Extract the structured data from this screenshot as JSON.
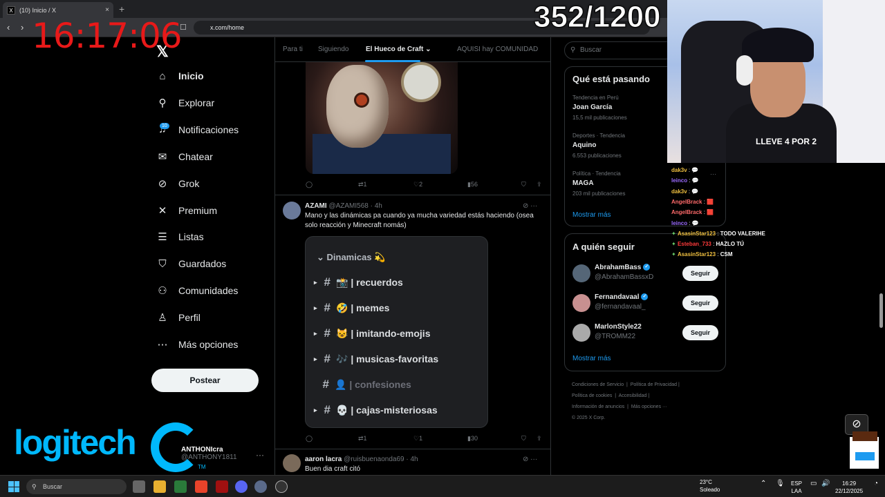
{
  "browser": {
    "tab_title": "(10) Inicio / X",
    "tab_favicon": "X",
    "tab_close": "×",
    "new_tab": "+",
    "url": "x.com/home"
  },
  "overlay": {
    "clock": "16:17:06",
    "counter": "352/1200"
  },
  "sidebar": {
    "logo": "𝕏",
    "notif_badge": "10",
    "items": [
      {
        "label": "Inicio",
        "icon": "home-icon",
        "glyph": "⌂"
      },
      {
        "label": "Explorar",
        "icon": "search-icon",
        "glyph": "⚲"
      },
      {
        "label": "Notificaciones",
        "icon": "bell-icon",
        "glyph": "♫"
      },
      {
        "label": "Chatear",
        "icon": "mail-icon",
        "glyph": "✉"
      },
      {
        "label": "Grok",
        "icon": "grok-icon",
        "glyph": "⊘"
      },
      {
        "label": "Premium",
        "icon": "x-icon",
        "glyph": "✕"
      },
      {
        "label": "Listas",
        "icon": "list-icon",
        "glyph": "☰"
      },
      {
        "label": "Guardados",
        "icon": "bookmark-icon",
        "glyph": "⛉"
      },
      {
        "label": "Comunidades",
        "icon": "people-icon",
        "glyph": "⚇"
      },
      {
        "label": "Perfil",
        "icon": "person-icon",
        "glyph": "♙"
      },
      {
        "label": "Más opciones",
        "icon": "more-circle-icon",
        "glyph": "⋯"
      }
    ],
    "post_button": "Postear",
    "account_name": "ANTHONIcra",
    "account_handle": "@ANTHONY1811",
    "account_more": "···"
  },
  "sponsor": {
    "name": "logitech",
    "tm": "TM"
  },
  "feed": {
    "tabs": [
      "Para ti",
      "Siguiendo",
      "El Hueco de Craft",
      "AQUISI hay COMUNIDAD"
    ],
    "tab_chevron": "⌄",
    "post1_actions": {
      "replies": "",
      "reposts": "1",
      "likes": "2",
      "views": "56"
    },
    "post2": {
      "name": "AZAMI",
      "handle": "@AZAMI568",
      "time": "· 4h",
      "text": "Mano y las dinámicas pa cuando ya mucha variedad estás haciendo (osea solo reacción y Minecraft nomás)",
      "actions": {
        "replies": "",
        "reposts": "1",
        "likes": "1",
        "views": "30"
      }
    },
    "discord": {
      "header": "Dinamicas 💫",
      "channels": [
        {
          "name": "| recuerdos",
          "emoji": "📸",
          "dim": false
        },
        {
          "name": "| memes",
          "emoji": "🤣",
          "dim": false
        },
        {
          "name": "| imitando-emojis",
          "emoji": "😺",
          "dim": false
        },
        {
          "name": "| musicas-favoritas",
          "emoji": "🎶",
          "dim": false
        },
        {
          "name": "| confesiones",
          "emoji": "👤",
          "dim": true
        },
        {
          "name": "| cajas-misteriosas",
          "emoji": "💀",
          "dim": false
        }
      ]
    },
    "post3": {
      "name": "aaron lacra",
      "handle": "@ruisbuenaonda69",
      "time": "· 4h",
      "text": "Buen dia craft citó"
    }
  },
  "right": {
    "search_placeholder": "Buscar",
    "trends_title": "Qué está pasando",
    "trends": [
      {
        "meta": "Tendencia en Perú",
        "name": "Joan García",
        "count": "15,5 mil publicaciones"
      },
      {
        "meta": "Deportes · Tendencia",
        "name": "Aquino",
        "count": "6.553 publicaciones"
      },
      {
        "meta": "Política · Tendencia",
        "name": "MAGA",
        "count": "203 mil publicaciones"
      }
    ],
    "trends_more": "Mostrar más",
    "follow_title": "A quién seguir",
    "follow": [
      {
        "name": "AbrahamBass",
        "handle": "@AbrahamBassxD",
        "btn": "Seguir"
      },
      {
        "name": "Fernandavaal",
        "handle": "@fernandavaal_",
        "btn": "Seguir"
      },
      {
        "name": "MarlonStyle22",
        "handle": "@TROMM22",
        "btn": "Seguir"
      }
    ],
    "follow_more": "Mostrar más",
    "footer": [
      "Condiciones de Servicio",
      "Política de Privacidad",
      "Política de cookies",
      "Accesibilidad",
      "Información de anuncios",
      "Más opciones ···",
      "© 2025 X Corp."
    ]
  },
  "chat": [
    {
      "user": "dak3v",
      "msg": "💬",
      "color": "#f0c040"
    },
    {
      "user": "leinco",
      "msg": "💬",
      "color": "#9b6bff"
    },
    {
      "user": "dak3v",
      "msg": "💬",
      "color": "#f0c040"
    },
    {
      "user": "AngelBrack",
      "msg": "🟥",
      "color": "#ff6a6a"
    },
    {
      "user": "AngelBrack",
      "msg": "🟥",
      "color": "#ff6a6a"
    },
    {
      "user": "leinco",
      "msg": "💬",
      "color": "#9b6bff"
    },
    {
      "user": "AsasinStar123",
      "msg": "TODO VALERIHE",
      "color": "#f0c040"
    },
    {
      "user": "Esteban_733",
      "msg": "HAZLO TÚ",
      "color": "#ff3b3b"
    },
    {
      "user": "AsasinStar123",
      "msg": "CSM",
      "color": "#f0c040"
    }
  ],
  "webcam": {
    "shirt_text": "LLEVE 4 POR 2"
  },
  "taskbar": {
    "search": "Buscar",
    "weather_temp": "23°C",
    "weather_desc": "Soleado",
    "lang1": "ESP",
    "lang2": "LAA",
    "time": "16:29",
    "date": "22/12/2025"
  }
}
